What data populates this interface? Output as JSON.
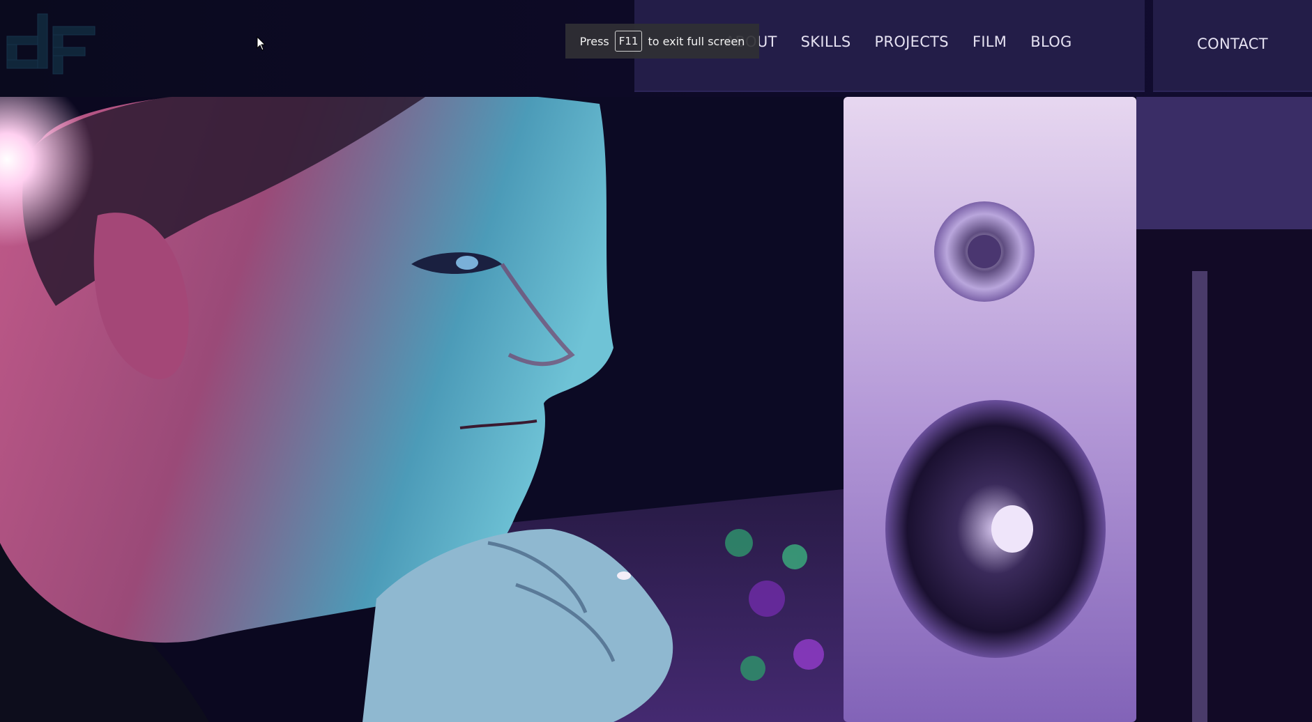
{
  "site": {
    "logo_text": "df"
  },
  "nav": {
    "items": [
      {
        "label": "ABOUT"
      },
      {
        "label": "SKILLS"
      },
      {
        "label": "PROJECTS"
      },
      {
        "label": "FILM"
      },
      {
        "label": "BLOG"
      }
    ],
    "contact_label": "CONTACT"
  },
  "fullscreen_notice": {
    "prefix": "Press",
    "key": "F11",
    "suffix": "to exit full screen"
  },
  "hero": {
    "image_subject": "man-with-chin-on-hand-studio-speaker"
  },
  "colors": {
    "nav_panel": "#231d48",
    "header_bg": "#0a0a1e",
    "nav_text": "#e6e2f2",
    "logo": "#0f2230"
  }
}
